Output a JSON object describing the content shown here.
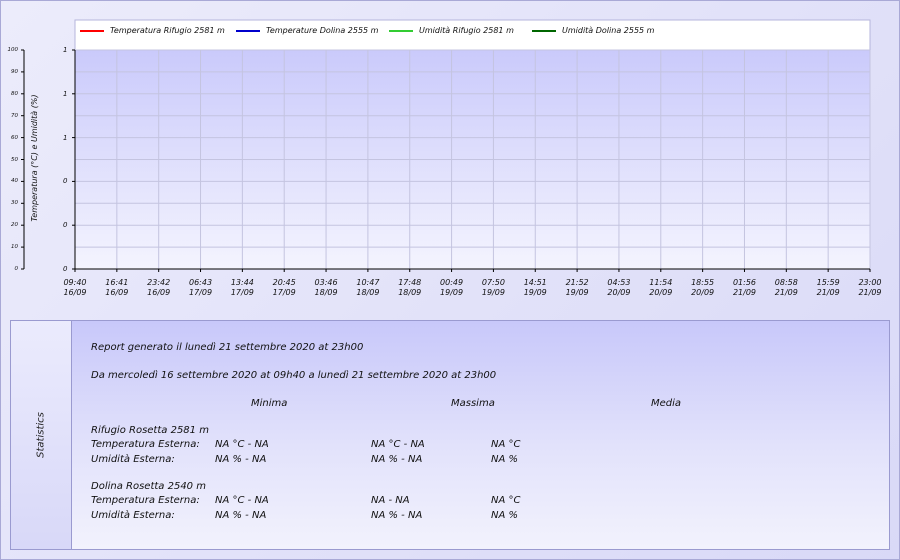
{
  "legend": [
    {
      "label": "Temperatura Rifugio 2581 m",
      "color": "#ff0000"
    },
    {
      "label": "Temperature Dolina 2555 m",
      "color": "#0000cc"
    },
    {
      "label": "Umidità Rifugio 2581 m",
      "color": "#33cc33"
    },
    {
      "label": "Umidità Dolina 2555 m",
      "color": "#006600"
    }
  ],
  "chart_data": {
    "type": "line",
    "series": [
      {
        "name": "Temperatura Rifugio 2581 m",
        "values": []
      },
      {
        "name": "Temperature Dolina 2555 m",
        "values": []
      },
      {
        "name": "Umidità Rifugio 2581 m",
        "values": []
      },
      {
        "name": "Umidità Dolina 2555 m",
        "values": []
      }
    ],
    "ylabel": "Temperatura (°C) e Umidità (%)",
    "left_axis_ticks": [
      "100",
      "90",
      "80",
      "70",
      "60",
      "50",
      "40",
      "30",
      "20",
      "10",
      "0"
    ],
    "inner_axis_ticks": [
      "1",
      "1",
      "1",
      "0",
      "0",
      "0"
    ],
    "x_ticks": [
      {
        "time": "09:40",
        "date": "16/09"
      },
      {
        "time": "16:41",
        "date": "16/09"
      },
      {
        "time": "23:42",
        "date": "16/09"
      },
      {
        "time": "06:43",
        "date": "17/09"
      },
      {
        "time": "13:44",
        "date": "17/09"
      },
      {
        "time": "20:45",
        "date": "17/09"
      },
      {
        "time": "03:46",
        "date": "18/09"
      },
      {
        "time": "10:47",
        "date": "18/09"
      },
      {
        "time": "17:48",
        "date": "18/09"
      },
      {
        "time": "00:49",
        "date": "19/09"
      },
      {
        "time": "07:50",
        "date": "19/09"
      },
      {
        "time": "14:51",
        "date": "19/09"
      },
      {
        "time": "21:52",
        "date": "19/09"
      },
      {
        "time": "04:53",
        "date": "20/09"
      },
      {
        "time": "11:54",
        "date": "20/09"
      },
      {
        "time": "18:55",
        "date": "20/09"
      },
      {
        "time": "01:56",
        "date": "21/09"
      },
      {
        "time": "08:58",
        "date": "21/09"
      },
      {
        "time": "15:59",
        "date": "21/09"
      },
      {
        "time": "23:00",
        "date": "21/09"
      }
    ],
    "grid": true,
    "legend_position": "top"
  },
  "stats": {
    "side_label": "Statistics",
    "report_line": "Report generato il  lunedì 21 settembre 2020 at 23h00",
    "range_line": "Da mercoledì 16 settembre 2020 at 09h40 a lunedì 21 settembre 2020 at 23h00",
    "col_min": "Minima",
    "col_max": "Massima",
    "col_avg": "Media",
    "station1": {
      "name": "Rifugio Rosetta 2581 m",
      "temp_label": "Temperatura Esterna:",
      "temp_min": "NA °C - NA",
      "temp_max": "NA °C - NA",
      "temp_avg": "NA °C",
      "hum_label": "Umidità Esterna:",
      "hum_min": "NA % - NA",
      "hum_max": "NA % - NA",
      "hum_avg": "NA %"
    },
    "station2": {
      "name": "Dolina Rosetta 2540 m",
      "temp_label": "Temperatura Esterna:",
      "temp_min": "NA °C - NA",
      "temp_max": "NA  - NA",
      "temp_avg": "NA °C",
      "hum_label": "Umidità Esterna:",
      "hum_min": "NA % - NA",
      "hum_max": "NA % - NA",
      "hum_avg": "NA %"
    }
  }
}
